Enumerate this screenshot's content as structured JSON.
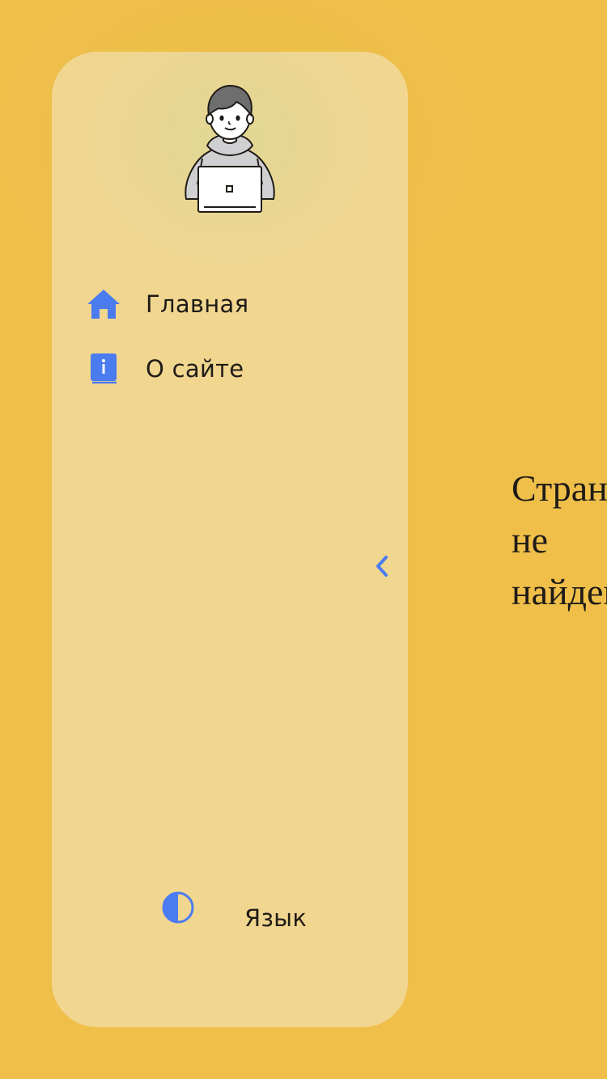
{
  "colors": {
    "background": "#efbf4a",
    "sidebar": "#f1d690",
    "accent": "#4a7cf0",
    "text": "#1f1b16"
  },
  "avatar": {
    "icon": "person-with-laptop-illustration"
  },
  "nav": {
    "items": [
      {
        "label": "Главная",
        "icon": "home-icon"
      },
      {
        "label": "О сайте",
        "icon": "info-book-icon"
      }
    ]
  },
  "sidebar": {
    "collapse_icon": "chevron-left-icon",
    "theme_icon": "half-circle-contrast-icon",
    "language_label": "Язык"
  },
  "main": {
    "not_found_lines": [
      "Страница",
      "не",
      "найдена"
    ]
  }
}
